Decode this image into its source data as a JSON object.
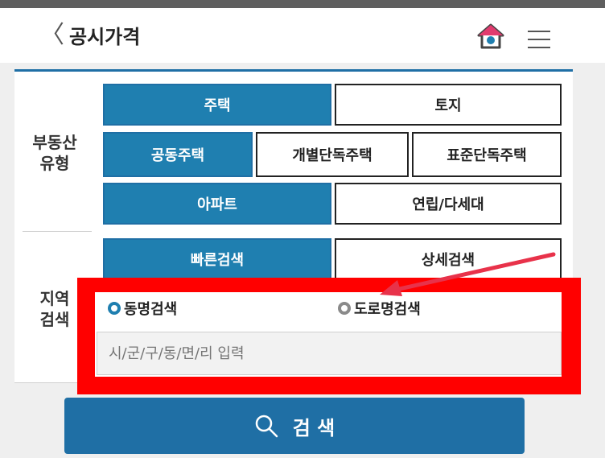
{
  "header": {
    "back_icon": "chevron-left-icon",
    "title": "공시가격",
    "home_icon": "home-icon",
    "menu_icon": "hamburger-menu-icon"
  },
  "property_type": {
    "label_line1": "부동산",
    "label_line2": "유형",
    "row1": [
      "주택",
      "토지"
    ],
    "row2": [
      "공동주택",
      "개별단독주택",
      "표준단독주택"
    ],
    "row3": [
      "아파트",
      "연립/다세대"
    ]
  },
  "region_search": {
    "label_line1": "지역",
    "label_line2": "검색",
    "modes": [
      "빠른검색",
      "상세검색"
    ],
    "radio_options": [
      "동명검색",
      "도로명검색"
    ],
    "input_placeholder": "시/군/구/동/면/리 입력"
  },
  "search_button": {
    "label": "검 색",
    "icon": "search-icon"
  },
  "colors": {
    "accent": "#1f7fb0",
    "highlight": "#ff0000"
  }
}
